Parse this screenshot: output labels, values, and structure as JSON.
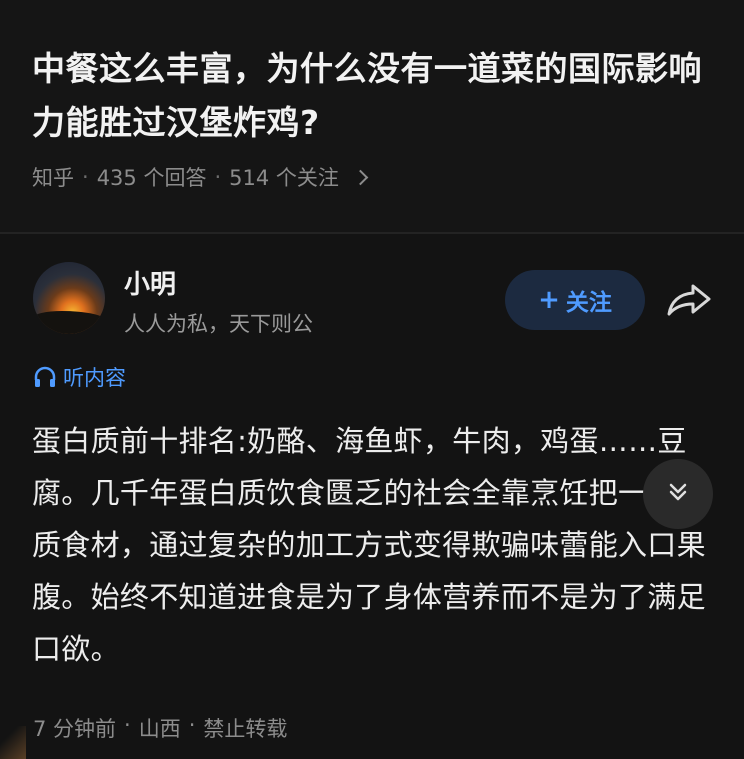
{
  "question": {
    "title": "中餐这么丰富，为什么没有一道菜的国际影响力能胜过汉堡炸鸡?",
    "source": "知乎",
    "answers_count": "435 个回答",
    "followers_count": "514 个关注",
    "separator": "·"
  },
  "author": {
    "name": "小明",
    "bio": "人人为私，天下则公",
    "follow_label": "关注",
    "follow_plus": "+"
  },
  "listen": {
    "label": "听内容"
  },
  "answer": {
    "text": "蛋白质前十排名:奶酪、海鱼虾，牛肉，鸡蛋……豆腐。几千年蛋白质饮食匮乏的社会全靠烹饪把一些劣质食材，通过复杂的加工方式变得欺骗味蕾能入口果腹。始终不知道进食是为了身体营养而不是为了满足口欲。",
    "time": "7 分钟前",
    "location": "山西",
    "copyright": "禁止转载",
    "separator": "·"
  },
  "icons": {
    "share": "share-icon",
    "expand": "chevron-double-down-icon",
    "listen": "headphones-icon",
    "question_more": "chevron-right-icon"
  },
  "colors": {
    "background": "#121212",
    "accent": "#4f9bff",
    "follow_bg": "#1c2a40"
  }
}
